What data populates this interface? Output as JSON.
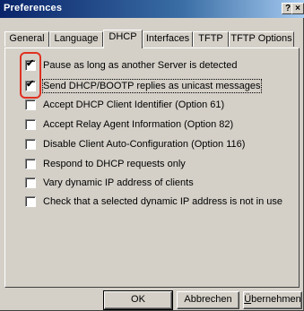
{
  "window": {
    "title": "Preferences",
    "help_button": "?",
    "close_button": "×"
  },
  "tabs": [
    {
      "label": "General",
      "active": false
    },
    {
      "label": "Language",
      "active": false
    },
    {
      "label": "DHCP",
      "active": true
    },
    {
      "label": "Interfaces",
      "active": false
    },
    {
      "label": "TFTP",
      "active": false
    },
    {
      "label": "TFTP Options",
      "active": false
    }
  ],
  "options": [
    {
      "label": "Pause as long as another Server is detected",
      "checked": true
    },
    {
      "label": "Send DHCP/BOOTP replies as unicast messages",
      "checked": true
    },
    {
      "label": "Accept DHCP Client Identifier (Option 61)",
      "checked": false
    },
    {
      "label": "Accept Relay Agent Information (Option 82)",
      "checked": false
    },
    {
      "label": "Disable Client Auto-Configuration (Option 116)",
      "checked": false
    },
    {
      "label": "Respond to DHCP requests only",
      "checked": false
    },
    {
      "label": "Vary dynamic IP address of clients",
      "checked": false
    },
    {
      "label": "Check that a selected dynamic IP address is not in use",
      "checked": false
    }
  ],
  "buttons": {
    "ok": "OK",
    "cancel": "Abbrechen",
    "apply_u": "Ü",
    "apply_rest": "bernehmen"
  },
  "colors": {
    "highlight": "#e03020",
    "title_start": "#0a246a",
    "face": "#d4d0c8"
  }
}
